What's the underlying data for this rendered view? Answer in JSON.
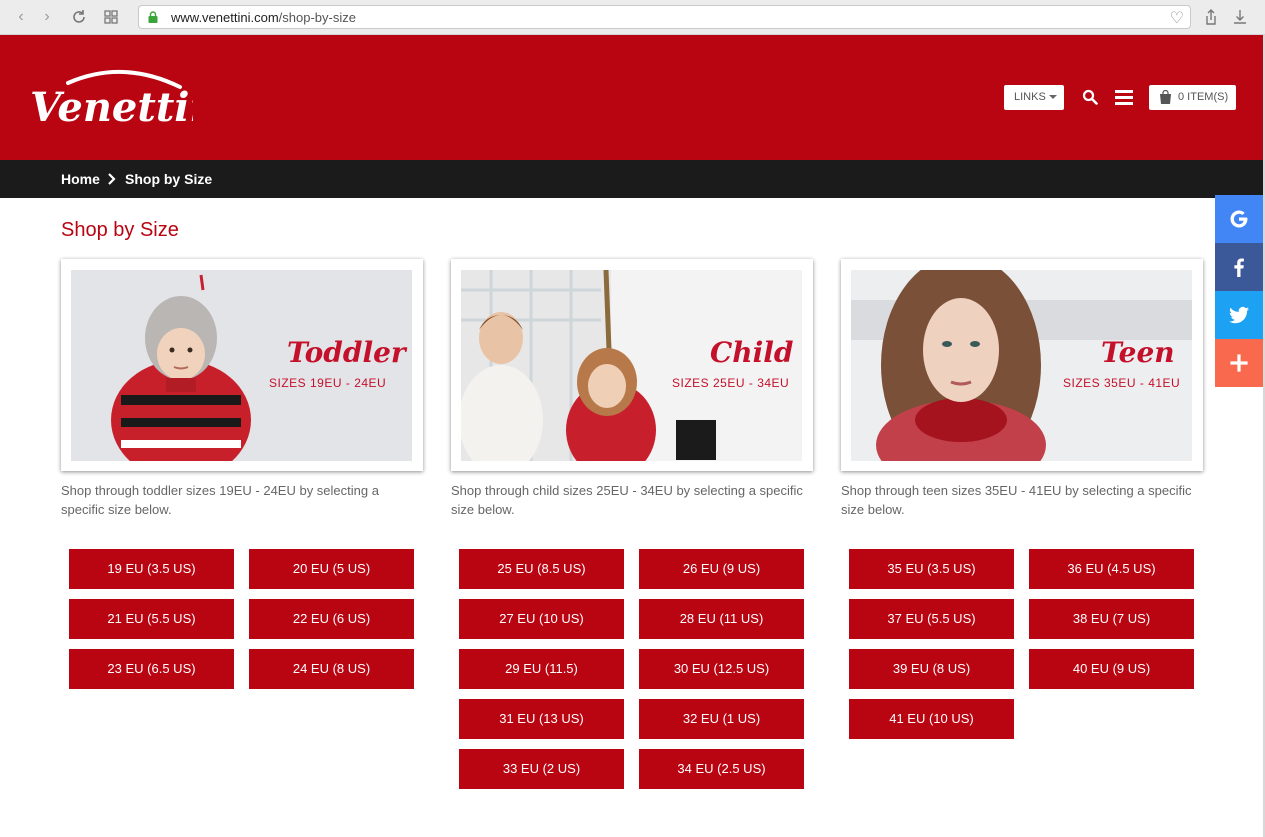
{
  "browser": {
    "url_host": "www.venettini.com",
    "url_path": "/shop-by-size"
  },
  "header": {
    "logo_text": "Venettini",
    "links_label": "LINKS",
    "cart_label": "0 ITEM(S)",
    "brand_color": "#b90412"
  },
  "breadcrumb": {
    "home": "Home",
    "current": "Shop by Size"
  },
  "page": {
    "title": "Shop by Size"
  },
  "categories": [
    {
      "title": "Toddler",
      "sizes_label": "SIZES 19EU - 24EU",
      "description": "Shop through toddler sizes 19EU - 24EU by selecting a specific size below.",
      "buttons": [
        "19 EU (3.5 US)",
        "20 EU (5 US)",
        "21 EU (5.5 US)",
        "22 EU (6 US)",
        "23 EU (6.5 US)",
        "24 EU (8 US)"
      ]
    },
    {
      "title": "Child",
      "sizes_label": "SIZES 25EU - 34EU",
      "description": "Shop through child sizes 25EU - 34EU by selecting a specific size below.",
      "buttons": [
        "25 EU (8.5 US)",
        "26 EU (9 US)",
        "27 EU (10 US)",
        "28 EU (11 US)",
        "29 EU (11.5)",
        "30 EU (12.5 US)",
        "31 EU (13 US)",
        "32 EU (1 US)",
        "33 EU (2 US)",
        "34 EU (2.5 US)"
      ]
    },
    {
      "title": "Teen",
      "sizes_label": "SIZES 35EU - 41EU",
      "description": "Shop through teen sizes 35EU - 41EU by selecting a specific size below.",
      "buttons": [
        "35 EU (3.5 US)",
        "36 EU (4.5 US)",
        "37 EU (5.5 US)",
        "38 EU (7 US)",
        "39 EU (8 US)",
        "40 EU (9 US)",
        "41 EU (10 US)"
      ]
    }
  ],
  "share": [
    {
      "icon": "google-icon",
      "color": "#4285f4"
    },
    {
      "icon": "facebook-icon",
      "color": "#3b5998"
    },
    {
      "icon": "twitter-icon",
      "color": "#1da1f2"
    },
    {
      "icon": "plus-icon",
      "color": "#f8694d"
    }
  ]
}
